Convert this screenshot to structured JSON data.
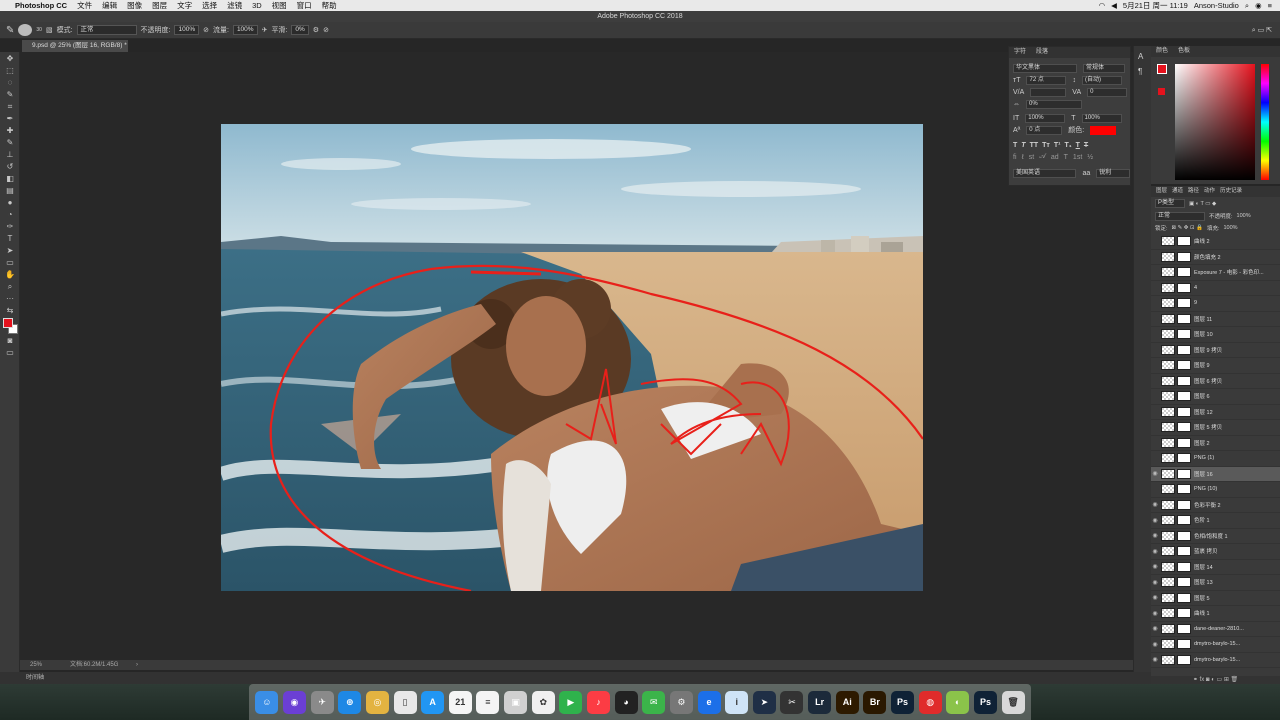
{
  "menubar": {
    "apple": "",
    "app_name": "Photoshop CC",
    "items": [
      "文件",
      "编辑",
      "图像",
      "图层",
      "文字",
      "选择",
      "滤镜",
      "3D",
      "视图",
      "窗口",
      "帮助"
    ],
    "clock": "5月21日 周一  11:19",
    "user": "Anson-Studio"
  },
  "window": {
    "title": "Adobe Photoshop CC 2018"
  },
  "options": {
    "mode_label": "模式:",
    "mode_value": "正常",
    "opacity_label": "不透明度:",
    "opacity_value": "100%",
    "flow_label": "流量:",
    "flow_value": "100%",
    "smooth_label": "平滑:",
    "smooth_value": "0%",
    "brush_size": "30"
  },
  "document": {
    "tab": "9.psd @ 25% (图层 16, RGB/8) *"
  },
  "status": {
    "zoom": "25%",
    "doc": "文档:60.2M/1.45G"
  },
  "timeline": {
    "label": "时间轴"
  },
  "character": {
    "tab1": "字符",
    "tab2": "段落",
    "font_family": "华文黑体",
    "font_style": "常规体",
    "font_size": "72 点",
    "leading": "(自动)",
    "kerning": "",
    "tracking": "0",
    "scale_pct": "0%",
    "vscale": "100%",
    "hscale": "100%",
    "baseline": "0 点",
    "color_label": "颜色:",
    "language": "美国英语",
    "antialias": "锐利",
    "color_value": "#ff0000"
  },
  "color_panel": {
    "tab1": "颜色",
    "tab2": "色板",
    "fg": "#e5121d",
    "bg": "#ffffff"
  },
  "layers_panel": {
    "tabs": [
      "图层",
      "通道",
      "路径",
      "动作",
      "历史记录"
    ],
    "filter": "P类型",
    "blend": "正常",
    "opacity_label": "不透明度:",
    "opacity": "100%",
    "lock_label": "锁定:",
    "fill_label": "填充:",
    "fill": "100%",
    "layers": [
      {
        "name": "曲线 2",
        "visible": false
      },
      {
        "name": "颜色填充 2",
        "visible": false
      },
      {
        "name": "Exposure 7 - 电影 - 彩色印...",
        "visible": false
      },
      {
        "name": "4",
        "visible": false
      },
      {
        "name": "9",
        "visible": false
      },
      {
        "name": "图层 11",
        "visible": false
      },
      {
        "name": "图层 10",
        "visible": false
      },
      {
        "name": "图层 9 拷贝",
        "visible": false
      },
      {
        "name": "图层 9",
        "visible": false
      },
      {
        "name": "图层 6 拷贝",
        "visible": false
      },
      {
        "name": "图层 6",
        "visible": false
      },
      {
        "name": "图层 12",
        "visible": false
      },
      {
        "name": "图层 5 拷贝",
        "visible": false
      },
      {
        "name": "图层 2",
        "visible": false
      },
      {
        "name": "PNG (1)",
        "visible": false
      },
      {
        "name": "图层 16",
        "visible": true,
        "selected": true
      },
      {
        "name": "PNG (10)",
        "visible": false
      },
      {
        "name": "色彩平衡 2",
        "visible": true
      },
      {
        "name": "色阶 1",
        "visible": true
      },
      {
        "name": "色相/饱和度 1",
        "visible": true
      },
      {
        "name": "蓝裹 拷贝",
        "visible": true
      },
      {
        "name": "图层 14",
        "visible": true
      },
      {
        "name": "图层 13",
        "visible": true
      },
      {
        "name": "图层 5",
        "visible": true
      },
      {
        "name": "曲线 1",
        "visible": true
      },
      {
        "name": "dane-deaner-2810...",
        "visible": true
      },
      {
        "name": "dmytro-barylo-15...",
        "visible": true
      },
      {
        "name": "dmytro-barylo-15...",
        "visible": true
      }
    ]
  },
  "dock": {
    "icons": [
      {
        "name": "finder",
        "color": "#3a8ee6",
        "glyph": "☺"
      },
      {
        "name": "siri",
        "color": "#6b3fd4",
        "glyph": "◉"
      },
      {
        "name": "launchpad",
        "color": "#8a8a8a",
        "glyph": "✈"
      },
      {
        "name": "safari",
        "color": "#1e88e5",
        "glyph": "⊕"
      },
      {
        "name": "chrome",
        "color": "#e3b341",
        "glyph": "◎"
      },
      {
        "name": "preview",
        "color": "#e8e8e8",
        "glyph": "▯"
      },
      {
        "name": "app-store",
        "color": "#2196f3",
        "glyph": "A"
      },
      {
        "name": "calendar",
        "color": "#f5f5f5",
        "glyph": "21"
      },
      {
        "name": "notes",
        "color": "#f4f4f4",
        "glyph": "≡"
      },
      {
        "name": "preview-photos",
        "color": "#d0d0d0",
        "glyph": "▣"
      },
      {
        "name": "photos",
        "color": "#f0f0f0",
        "glyph": "✿"
      },
      {
        "name": "facetime",
        "color": "#2fb24c",
        "glyph": "▶"
      },
      {
        "name": "music",
        "color": "#fc3c44",
        "glyph": "♪"
      },
      {
        "name": "qq",
        "color": "#222",
        "glyph": "◕"
      },
      {
        "name": "wechat",
        "color": "#3bb44a",
        "glyph": "✉"
      },
      {
        "name": "system-preferences",
        "color": "#777",
        "glyph": "⚙"
      },
      {
        "name": "browser",
        "color": "#1c6fe8",
        "glyph": "e"
      },
      {
        "name": "instruments",
        "color": "#cfe4f7",
        "glyph": "i"
      },
      {
        "name": "vector",
        "color": "#1f2f46",
        "glyph": "➤"
      },
      {
        "name": "final-cut",
        "color": "#333",
        "glyph": "✂"
      },
      {
        "name": "lightroom",
        "color": "#1c2a3a",
        "glyph": "Lr"
      },
      {
        "name": "illustrator",
        "color": "#2d1a00",
        "glyph": "Ai"
      },
      {
        "name": "bridge",
        "color": "#2a1800",
        "glyph": "Br"
      },
      {
        "name": "photoshop",
        "color": "#0f2236",
        "glyph": "Ps"
      },
      {
        "name": "netease-music",
        "color": "#e02b2b",
        "glyph": "◍"
      },
      {
        "name": "qq-browser",
        "color": "#8bc34a",
        "glyph": "◐"
      },
      {
        "name": "psd-file",
        "color": "#0f2236",
        "glyph": "Ps"
      },
      {
        "name": "trash",
        "color": "#d8d8d8",
        "glyph": "🗑"
      }
    ]
  }
}
